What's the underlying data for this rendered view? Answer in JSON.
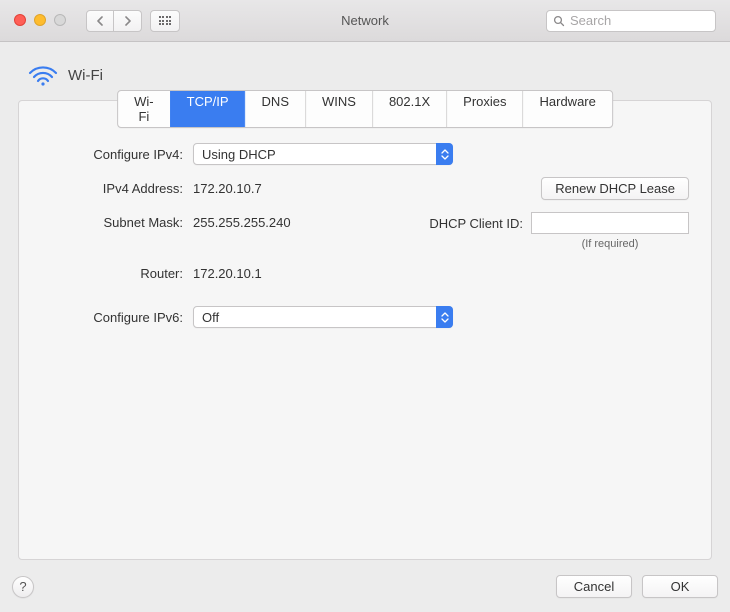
{
  "window": {
    "title": "Network"
  },
  "search": {
    "placeholder": "Search"
  },
  "header": {
    "title": "Wi-Fi"
  },
  "tabs": [
    "Wi-Fi",
    "TCP/IP",
    "DNS",
    "WINS",
    "802.1X",
    "Proxies",
    "Hardware"
  ],
  "active_tab": 1,
  "labels": {
    "configure_ipv4": "Configure IPv4:",
    "ipv4_address": "IPv4 Address:",
    "subnet_mask": "Subnet Mask:",
    "router": "Router:",
    "configure_ipv6": "Configure IPv6:",
    "dhcp_client_id": "DHCP Client ID:"
  },
  "values": {
    "configure_ipv4": "Using DHCP",
    "ipv4_address": "172.20.10.7",
    "subnet_mask": "255.255.255.240",
    "router": "172.20.10.1",
    "configure_ipv6": "Off",
    "dhcp_client_id": ""
  },
  "buttons": {
    "renew_dhcp": "Renew DHCP Lease",
    "cancel": "Cancel",
    "ok": "OK",
    "help": "?"
  },
  "hints": {
    "if_required": "(If required)"
  }
}
